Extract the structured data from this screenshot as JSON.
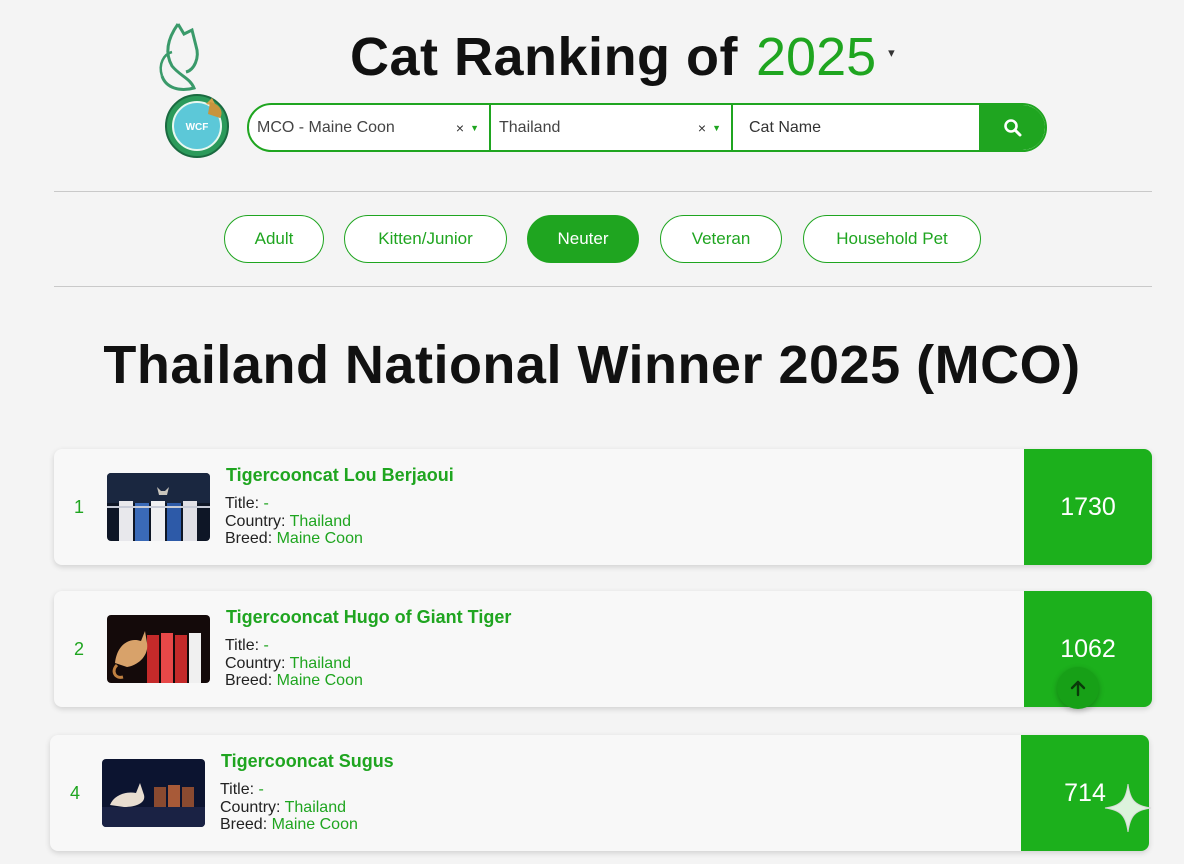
{
  "header": {
    "title": "Cat Ranking of",
    "year": "2025",
    "year_caret": "▾"
  },
  "search": {
    "breed_value": "MCO - Maine Coon",
    "country_value": "Thailand",
    "clear_symbol": "×",
    "dropdown_symbol": "▼",
    "name_placeholder": "Cat Name",
    "search_icon": "search-icon"
  },
  "tabs": [
    {
      "label": "Adult",
      "active": false
    },
    {
      "label": "Kitten/Junior",
      "active": false
    },
    {
      "label": "Neuter",
      "active": true
    },
    {
      "label": "Veteran",
      "active": false
    },
    {
      "label": "Household Pet",
      "active": false
    }
  ],
  "section_title": "Thailand National Winner 2025 (MCO)",
  "labels": {
    "title": "Title:",
    "country": "Country:",
    "breed": "Breed:"
  },
  "rankings": [
    {
      "rank": "1",
      "name": "Tigercooncat Lou Berjaoui",
      "title": "-",
      "country": "Thailand",
      "breed": "Maine Coon",
      "score": "1730"
    },
    {
      "rank": "2",
      "name": "Tigercooncat Hugo of Giant Tiger",
      "title": "-",
      "country": "Thailand",
      "breed": "Maine Coon",
      "score": "1062"
    },
    {
      "rank": "4",
      "name": "Tigercooncat Sugus",
      "title": "-",
      "country": "Thailand",
      "breed": "Maine Coon",
      "score": "714"
    }
  ],
  "colors": {
    "accent": "#1fa520",
    "score_bg": "#1cb01c",
    "background": "#f4f4f4"
  },
  "icons": [
    "logo-cat-icon",
    "search-icon",
    "arrow-up-icon",
    "sparkle-icon"
  ]
}
